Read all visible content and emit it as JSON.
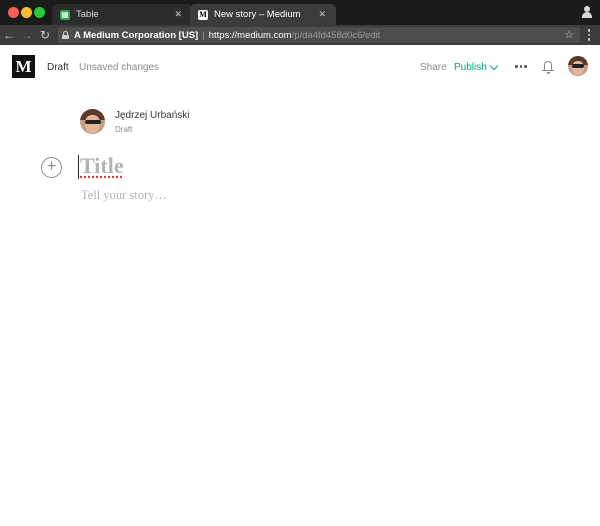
{
  "browser": {
    "tabs": [
      {
        "title": "Table",
        "icon": "sheet-icon"
      },
      {
        "title": "New story – Medium",
        "icon": "medium-favicon",
        "active": true
      }
    ],
    "address": {
      "organization": "A Medium Corporation [US]",
      "url_main": "https://medium.com",
      "url_rest": "/p/da4fd458d0c6/edit"
    }
  },
  "header": {
    "logo": "M",
    "draft_label": "Draft",
    "status": "Unsaved changes",
    "share_label": "Share",
    "publish_label": "Publish"
  },
  "author": {
    "name": "Jędrzej Urbański",
    "status": "Draft"
  },
  "editor": {
    "add_symbol": "+",
    "title_placeholder": "Title",
    "body_placeholder": "Tell your story…"
  },
  "colors": {
    "accent": "#03a87c",
    "placeholder": "#b3b3b1"
  }
}
